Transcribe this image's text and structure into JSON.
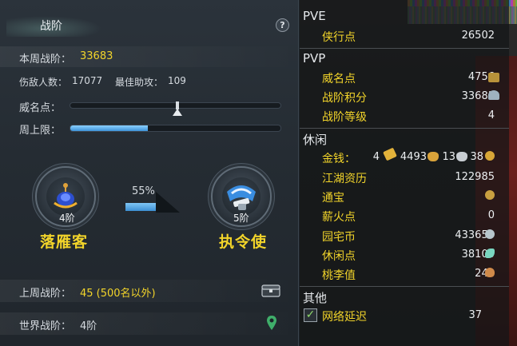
{
  "left": {
    "title": "战阶",
    "help": "?",
    "weekly_label": "本周战阶：",
    "weekly_value": "33683",
    "kills_label": "伤敌人数：",
    "kills_value": "17077",
    "assists_label": "最佳助攻：",
    "assists_value": "109",
    "prestige_label": "威名点：",
    "weekly_cap_label": "周上限：",
    "weekly_cap_fill": 0.37,
    "current_rank": {
      "tier": "4阶",
      "name": "落雁客"
    },
    "next_rank": {
      "tier": "5阶",
      "name": "执令使"
    },
    "progress_percent": "55%",
    "last_week_label": "上周战阶：",
    "last_week_value": "45 (500名以外)",
    "world_label": "世界战阶：",
    "world_value": "4阶"
  },
  "right": {
    "pve": {
      "title": "PVE",
      "items": [
        {
          "label": "侠行点",
          "value": "26502"
        }
      ]
    },
    "pvp": {
      "title": "PVP",
      "items": [
        {
          "label": "威名点",
          "value": "4756"
        },
        {
          "label": "战阶积分",
          "value": "33683"
        },
        {
          "label": "战阶等级",
          "value": "4"
        }
      ]
    },
    "leisure": {
      "title": "休闲",
      "money_label": "金钱：",
      "money_gold": "4",
      "money_silver": "4493",
      "money_copper": "13",
      "money_other": "38",
      "items": [
        {
          "label": "江湖资历",
          "value": "122985"
        },
        {
          "label": "通宝",
          "value": "0"
        },
        {
          "label": "薪火点",
          "value": "0"
        },
        {
          "label": "园宅币",
          "value": "433650"
        },
        {
          "label": "休闲点",
          "value": "38100"
        },
        {
          "label": "桃李值",
          "value": "240"
        }
      ]
    },
    "other": {
      "title": "其他",
      "items": [
        {
          "label": "网络延迟",
          "value": "37"
        }
      ]
    }
  },
  "colors": {
    "accent_yellow": "#f2d42a",
    "bar_blue": "#3e93d8"
  }
}
